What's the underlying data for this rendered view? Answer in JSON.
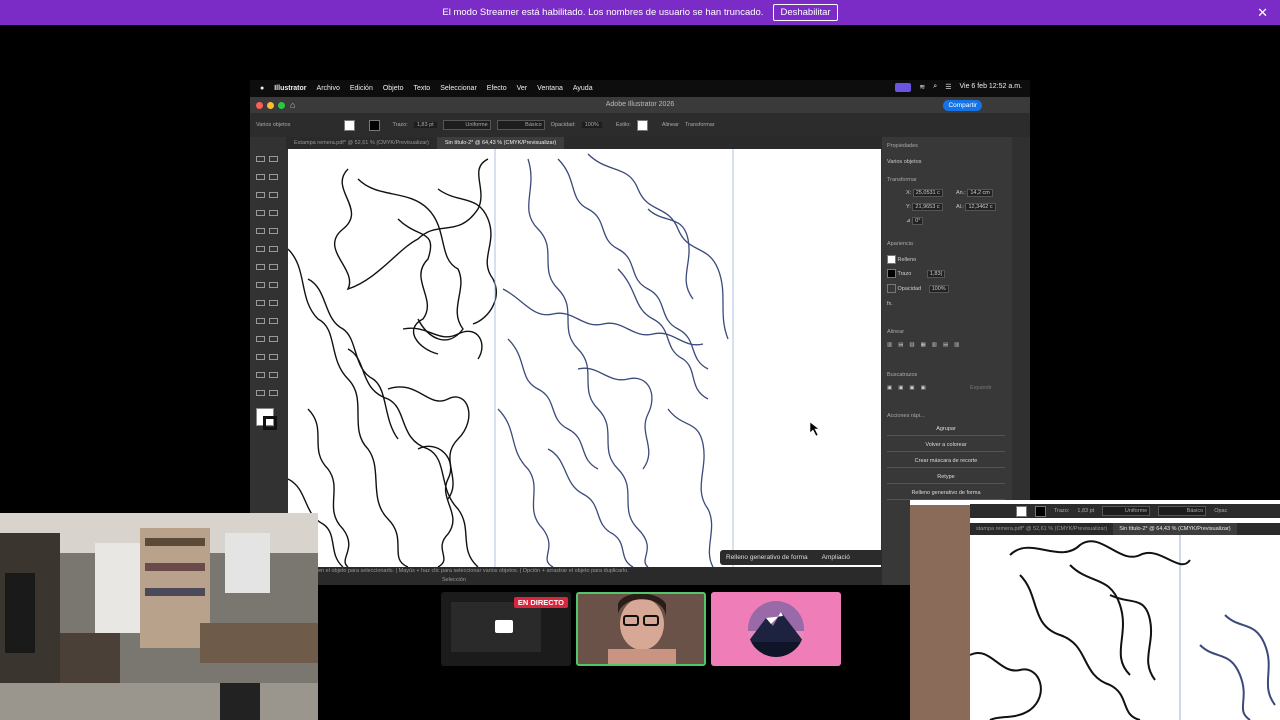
{
  "banner": {
    "message": "El modo Streamer está habilitado. Los nombres de usuario se han truncado.",
    "disable_label": "Deshabilitar",
    "close_glyph": "✕"
  },
  "mac_menu": {
    "app": "Illustrator",
    "items": [
      "Archivo",
      "Edición",
      "Objeto",
      "Texto",
      "Seleccionar",
      "Efecto",
      "Ver",
      "Ventana",
      "Ayuda"
    ],
    "datetime": "Vie 6 feb 12:52 a.m."
  },
  "window": {
    "title": "Adobe Illustrator 2026",
    "share_label": "Compartir"
  },
  "control_bar": {
    "selection": "Varios objetos",
    "stroke_label": "Trazo:",
    "stroke_value": "1,83 pt",
    "profile": "Uniforme",
    "brush": "Básico",
    "opacity_label": "Opacidad:",
    "opacity_value": "100%",
    "style_label": "Estilo:",
    "align_label": "Alinear",
    "transform_label": "Transformar"
  },
  "doc_tabs": [
    {
      "label": "Estampa remera.pdf* @ 52,61 % (CMYK/Previsualizar)",
      "active": false
    },
    {
      "label": "Sin título-2* @ 64,43 % (CMYK/Previsualizar)",
      "active": true
    }
  ],
  "status_bar": {
    "hint": "en el objeto para seleccionarlo. | Mayús + haz clic para seleccionar varios objetos. | Opción + arrastrar el objeto para duplicarlo.",
    "mode": "Selección"
  },
  "generative": {
    "label": "Relleno generativo de forma",
    "expand_label": "Ampliació"
  },
  "properties": {
    "title": "Propiedades",
    "selection": "Varios objetos",
    "transform_title": "Transformar",
    "x": "25,0531 c",
    "y": "21,9653 c",
    "w": "14,2 cm",
    "h": "12,3462 c",
    "w_label": "An.:",
    "h_label": "Al.:",
    "angle": "0°",
    "appearance_title": "Apariencia",
    "fill_label": "Relleno",
    "stroke_label": "Trazo",
    "stroke_value": "1,83(",
    "opacity_label": "Opacidad",
    "opacity_value": "100%",
    "fx_label": "fx.",
    "align_title": "Alinear",
    "pathfinder_title": "Buscatrazos",
    "expand_label": "Expandir",
    "quick_title": "Acciones rápi...",
    "quick_actions": [
      "Agrupar",
      "Volver a colorear",
      "Crear máscara de recorte",
      "Retype",
      "Relleno generativo de forma"
    ]
  },
  "stream_tray": {
    "live_label": "EN DIRECTO"
  },
  "zoom_view": {
    "stroke_label": "Trazo:",
    "stroke_value": "1,83 pt",
    "profile": "Uniforme",
    "brush": "Básico",
    "opacity_cut": "Opac",
    "tabs": [
      {
        "label": "stampa remera.pdf* @ 52,61 % (CMYK/Previsualizar)",
        "active": false
      },
      {
        "label": "Sin título-2* @ 64,43 % (CMYK/Previsualizar)",
        "active": true
      }
    ]
  },
  "colors": {
    "banner": "#7b2cc7",
    "accent_blue": "#1473e6",
    "live_red": "#d7263d",
    "active_speaker": "#52c66b",
    "logo_bg": "#ef7eb8",
    "selected_path": "#3a4a7a"
  },
  "icons": [
    "apple-icon",
    "home-icon",
    "search-icon",
    "wifi-icon",
    "control-center-icon",
    "close-icon",
    "cursor-icon",
    "mountain-logo-icon",
    "monitor-icon"
  ]
}
